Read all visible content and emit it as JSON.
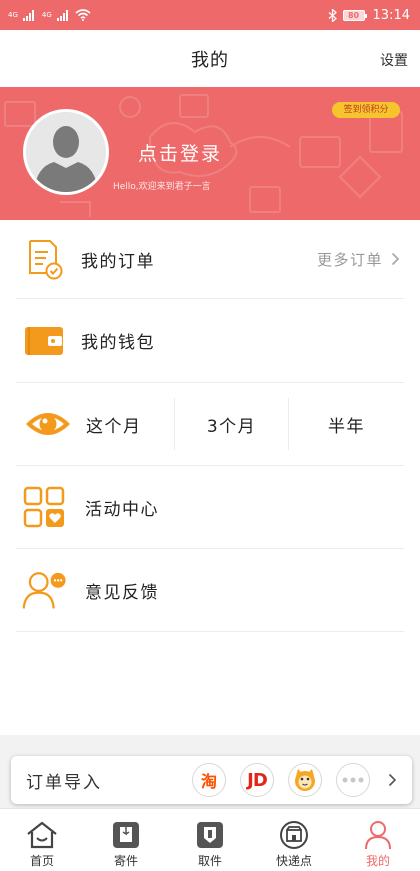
{
  "status_bar": {
    "signal_1_label": "4G",
    "signal_2_label": "4G",
    "battery": "80",
    "time": "13:14"
  },
  "header": {
    "title": "我的",
    "settings_label": "设置"
  },
  "profile": {
    "login_label": "点击登录",
    "welcome_text": "Hello,欢迎来到君子一言",
    "sign_badge": "签到领积分"
  },
  "menu": {
    "orders_label": "我的订单",
    "more_orders_label": "更多订单",
    "wallet_label": "我的钱包",
    "periods": [
      "这个月",
      "3个月",
      "半年"
    ],
    "activity_label": "活动中心",
    "feedback_label": "意见反馈"
  },
  "order_import": {
    "label": "订单导入",
    "taobao_label": "淘",
    "jd_label": "JD",
    "more_icon": "more-dots-icon"
  },
  "tabbar": {
    "items": [
      {
        "label": "首页",
        "icon": "home-icon"
      },
      {
        "label": "寄件",
        "icon": "send-icon"
      },
      {
        "label": "取件",
        "icon": "pickup-icon"
      },
      {
        "label": "快递点",
        "icon": "station-icon"
      },
      {
        "label": "我的",
        "icon": "profile-icon",
        "active": true
      }
    ]
  },
  "colors": {
    "brand": "#ee6a6a",
    "accent_orange": "#f39a1c",
    "badge_yellow": "#f6c52d"
  }
}
